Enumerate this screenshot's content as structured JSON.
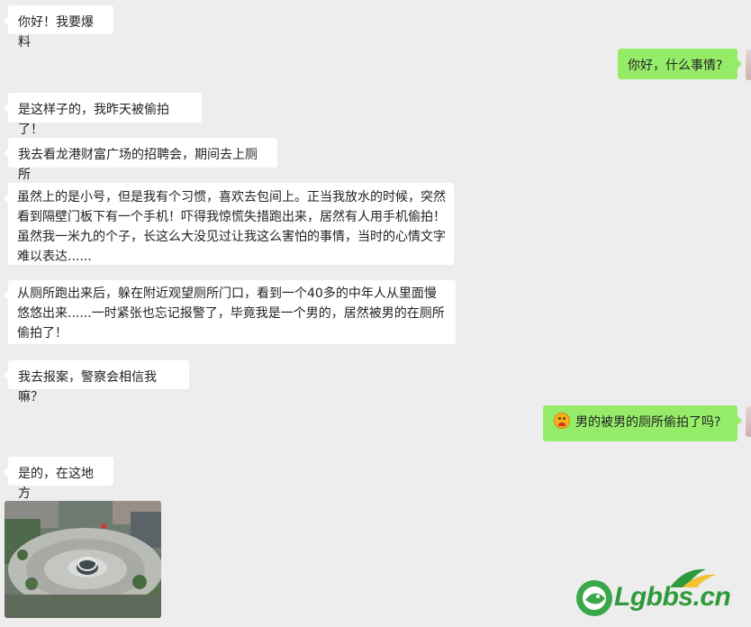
{
  "chat": {
    "messages": [
      {
        "id": "m1",
        "text": "你好！我要爆料"
      },
      {
        "id": "m2",
        "text": "你好，什么事情?"
      },
      {
        "id": "m3",
        "text": "是这样子的，我昨天被偷拍了！"
      },
      {
        "id": "m4",
        "text": "我去看龙港财富广场的招聘会，期间去上厕所"
      },
      {
        "id": "m5",
        "text": "虽然上的是小号，但是我有个习惯，喜欢去包间上。正当我放水的时候，突然看到隔壁门板下有一个手机！吓得我惊慌失措跑出来，居然有人用手机偷拍！虽然我一米九的个子，长这么大没见过让我这么害怕的事情，当时的心情文字难以表达......"
      },
      {
        "id": "m6",
        "text": "从厕所跑出来后，躲在附近观望厕所门口，看到一个40多的中年人从里面慢悠悠出来......一时紧张也忘记报警了，毕竟我是一个男的，居然被男的在厕所偷拍了！"
      },
      {
        "id": "m7",
        "text": "我去报案，警察会相信我嘛？"
      },
      {
        "id": "m8",
        "text": "男的被男的厕所偷拍了吗?",
        "icon": "angry-face-emoji-icon"
      },
      {
        "id": "m9",
        "text": "是的，在这地方"
      }
    ]
  },
  "watermark": {
    "text": "Lgbbs.cn",
    "icon": "dragon-logo-icon"
  },
  "colors": {
    "background": "#ededed",
    "incoming_bubble": "#ffffff",
    "outgoing_bubble": "#95ec69"
  }
}
